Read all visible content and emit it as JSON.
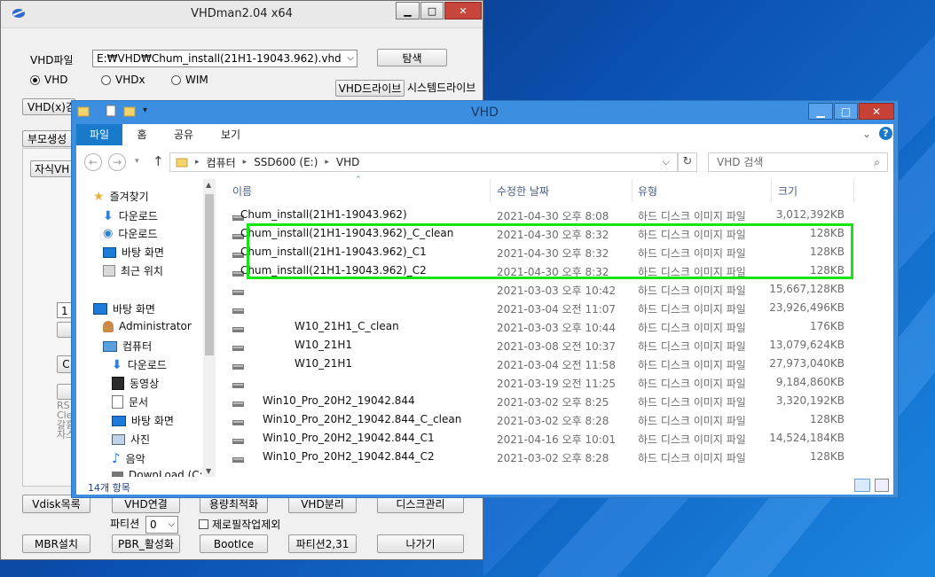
{
  "colors": {
    "desktop": "#0b4fb0",
    "highlight": "#14e614",
    "ribbon_active": "#1979ca",
    "explorer_frame": "#3c8fe0"
  },
  "vhdman": {
    "title": "VHDman2.04 x64",
    "vhd_file_label": "VHD파일",
    "vhd_path": "E:₩VHD₩Chum_install(21H1-19043.962).vhd",
    "browse_button": "탐색",
    "radios": [
      {
        "label": "VHD",
        "selected": true
      },
      {
        "label": "VHDx",
        "selected": false
      },
      {
        "label": "WIM",
        "selected": false
      }
    ],
    "vhd_drive_button": "VHD드라이브",
    "system_drive_label": "시스템드라이브",
    "partial_button_1": "VHD(x)검",
    "partial_button_2": "부모생성",
    "partial_button_3": "자식VH",
    "partial_field": "1",
    "partial_button_4": "C",
    "partial_text": [
      "RS",
      "Cle",
      "갈흉",
      "자스"
    ],
    "buttons_row1": [
      "Vdisk목록",
      "VHD연결",
      "용량최적화",
      "VHD분리",
      "디스크관리"
    ],
    "partition_label": "파티션",
    "partition_value": "0",
    "exclude_zero_label": "제로필작업제외",
    "buttons_row2": [
      "MBR설치",
      "PBR_활성화",
      "BootIce",
      "파티션2,31",
      "나가기"
    ]
  },
  "explorer": {
    "title": "VHD",
    "ribbon_tabs": [
      "파일",
      "홈",
      "공유",
      "보기"
    ],
    "breadcrumb": [
      "컴퓨터",
      "SSD600 (E:)",
      "VHD"
    ],
    "search_placeholder": "VHD 검색",
    "nav": {
      "favorites": "즐겨찾기",
      "fav_items": [
        "다운로드",
        "다운로드",
        "바탕 화면",
        "최근 위치"
      ],
      "desktop": "바탕 화면",
      "user": "Administrator",
      "computer": "컴퓨터",
      "computer_items": [
        "다운로드",
        "동영상",
        "문서",
        "바탕 화면",
        "사진",
        "음악",
        "DownLoad (C:)"
      ]
    },
    "columns": [
      "이름",
      "수정한 날짜",
      "유형",
      "크기"
    ],
    "files": [
      {
        "name": "Chum_install(21H1-19043.962)",
        "date": "2021-04-30 오후 8:08",
        "type": "하드 디스크 이미지 파일",
        "size": "3,012,392KB"
      },
      {
        "name": "Chum_install(21H1-19043.962)_C_clean",
        "date": "2021-04-30 오후 8:32",
        "type": "하드 디스크 이미지 파일",
        "size": "128KB"
      },
      {
        "name": "Chum_install(21H1-19043.962)_C1",
        "date": "2021-04-30 오후 8:32",
        "type": "하드 디스크 이미지 파일",
        "size": "128KB"
      },
      {
        "name": "Chum_install(21H1-19043.962)_C2",
        "date": "2021-04-30 오후 8:32",
        "type": "하드 디스크 이미지 파일",
        "size": "128KB"
      },
      {
        "name": "",
        "date": "2021-03-03 오후 10:42",
        "type": "하드 디스크 이미지 파일",
        "size": "15,667,128KB"
      },
      {
        "name": "",
        "date": "2021-03-04 오전 11:07",
        "type": "하드 디스크 이미지 파일",
        "size": "23,926,496KB"
      },
      {
        "name": "W10_21H1_C_clean",
        "date": "2021-03-03 오후 10:44",
        "type": "하드 디스크 이미지 파일",
        "size": "176KB"
      },
      {
        "name": "W10_21H1",
        "date": "2021-03-08 오전 10:37",
        "type": "하드 디스크 이미지 파일",
        "size": "13,079,624KB"
      },
      {
        "name": "W10_21H1",
        "date": "2021-03-04 오전 11:58",
        "type": "하드 디스크 이미지 파일",
        "size": "27,973,040KB"
      },
      {
        "name": "",
        "date": "2021-03-19 오전 11:25",
        "type": "하드 디스크 이미지 파일",
        "size": "9,184,860KB"
      },
      {
        "name": "Win10_Pro_20H2_19042.844",
        "date": "2021-03-02 오후 8:25",
        "type": "하드 디스크 이미지 파일",
        "size": "3,320,192KB"
      },
      {
        "name": "Win10_Pro_20H2_19042.844_C_clean",
        "date": "2021-03-02 오후 8:28",
        "type": "하드 디스크 이미지 파일",
        "size": "128KB"
      },
      {
        "name": "Win10_Pro_20H2_19042.844_C1",
        "date": "2021-04-16 오후 10:01",
        "type": "하드 디스크 이미지 파일",
        "size": "14,524,184KB"
      },
      {
        "name": "Win10_Pro_20H2_19042.844_C2",
        "date": "2021-03-02 오후 8:28",
        "type": "하드 디스크 이미지 파일",
        "size": "128KB"
      }
    ],
    "status": "14개 항목"
  }
}
